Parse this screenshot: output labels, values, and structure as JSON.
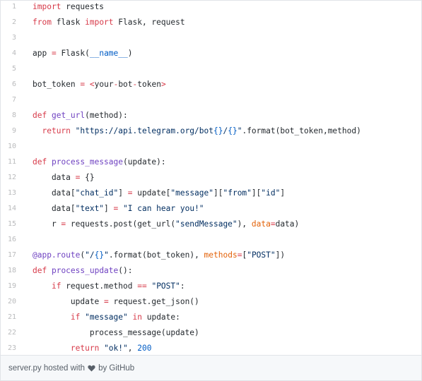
{
  "code": {
    "lines": [
      {
        "n": "1",
        "tokens": [
          [
            "k",
            "import"
          ],
          [
            "p",
            " requests"
          ]
        ]
      },
      {
        "n": "2",
        "tokens": [
          [
            "k",
            "from"
          ],
          [
            "p",
            " flask "
          ],
          [
            "k",
            "import"
          ],
          [
            "p",
            " Flask, request"
          ]
        ]
      },
      {
        "n": "3",
        "tokens": []
      },
      {
        "n": "4",
        "tokens": [
          [
            "p",
            "app "
          ],
          [
            "k",
            "="
          ],
          [
            "p",
            " Flask("
          ],
          [
            "c",
            "__name__"
          ],
          [
            "p",
            ")"
          ]
        ]
      },
      {
        "n": "5",
        "tokens": []
      },
      {
        "n": "6",
        "tokens": [
          [
            "p",
            "bot_token "
          ],
          [
            "k",
            "="
          ],
          [
            "p",
            " "
          ],
          [
            "k",
            "<"
          ],
          [
            "p",
            "your"
          ],
          [
            "k",
            "-"
          ],
          [
            "p",
            "bot"
          ],
          [
            "k",
            "-"
          ],
          [
            "p",
            "token"
          ],
          [
            "k",
            ">"
          ]
        ]
      },
      {
        "n": "7",
        "tokens": []
      },
      {
        "n": "8",
        "tokens": [
          [
            "k",
            "def"
          ],
          [
            "p",
            " "
          ],
          [
            "f",
            "get_url"
          ],
          [
            "p",
            "(method):"
          ]
        ]
      },
      {
        "n": "9",
        "tokens": [
          [
            "p",
            "  "
          ],
          [
            "k",
            "return"
          ],
          [
            "p",
            " "
          ],
          [
            "s",
            "\"https://api.telegram.org/bot"
          ],
          [
            "c",
            "{}"
          ],
          [
            "s",
            "/"
          ],
          [
            "c",
            "{}"
          ],
          [
            "s",
            "\""
          ],
          [
            "p",
            ".format(bot_token,method)"
          ]
        ]
      },
      {
        "n": "10",
        "tokens": []
      },
      {
        "n": "11",
        "tokens": [
          [
            "k",
            "def"
          ],
          [
            "p",
            " "
          ],
          [
            "f",
            "process_message"
          ],
          [
            "p",
            "(update):"
          ]
        ]
      },
      {
        "n": "12",
        "tokens": [
          [
            "p",
            "    data "
          ],
          [
            "k",
            "="
          ],
          [
            "p",
            " {}"
          ]
        ]
      },
      {
        "n": "13",
        "tokens": [
          [
            "p",
            "    data["
          ],
          [
            "s",
            "\"chat_id\""
          ],
          [
            "p",
            "] "
          ],
          [
            "k",
            "="
          ],
          [
            "p",
            " update["
          ],
          [
            "s",
            "\"message\""
          ],
          [
            "p",
            "]["
          ],
          [
            "s",
            "\"from\""
          ],
          [
            "p",
            "]["
          ],
          [
            "s",
            "\"id\""
          ],
          [
            "p",
            "]"
          ]
        ]
      },
      {
        "n": "14",
        "tokens": [
          [
            "p",
            "    data["
          ],
          [
            "s",
            "\"text\""
          ],
          [
            "p",
            "] "
          ],
          [
            "k",
            "="
          ],
          [
            "p",
            " "
          ],
          [
            "s",
            "\"I can hear you!\""
          ]
        ]
      },
      {
        "n": "15",
        "tokens": [
          [
            "p",
            "    r "
          ],
          [
            "k",
            "="
          ],
          [
            "p",
            " requests.post(get_url("
          ],
          [
            "s",
            "\"sendMessage\""
          ],
          [
            "p",
            "), "
          ],
          [
            "a",
            "data"
          ],
          [
            "k",
            "="
          ],
          [
            "p",
            "data)"
          ]
        ]
      },
      {
        "n": "16",
        "tokens": []
      },
      {
        "n": "17",
        "tokens": [
          [
            "f",
            "@app.route"
          ],
          [
            "p",
            "("
          ],
          [
            "s",
            "\"/"
          ],
          [
            "c",
            "{}"
          ],
          [
            "s",
            "\""
          ],
          [
            "p",
            ".format(bot_token), "
          ],
          [
            "a",
            "methods"
          ],
          [
            "k",
            "="
          ],
          [
            "p",
            "["
          ],
          [
            "s",
            "\"POST\""
          ],
          [
            "p",
            "])"
          ]
        ]
      },
      {
        "n": "18",
        "tokens": [
          [
            "k",
            "def"
          ],
          [
            "p",
            " "
          ],
          [
            "f",
            "process_update"
          ],
          [
            "p",
            "():"
          ]
        ]
      },
      {
        "n": "19",
        "tokens": [
          [
            "p",
            "    "
          ],
          [
            "k",
            "if"
          ],
          [
            "p",
            " request.method "
          ],
          [
            "k",
            "=="
          ],
          [
            "p",
            " "
          ],
          [
            "s",
            "\"POST\""
          ],
          [
            "p",
            ":"
          ]
        ]
      },
      {
        "n": "20",
        "tokens": [
          [
            "p",
            "        update "
          ],
          [
            "k",
            "="
          ],
          [
            "p",
            " request.get_json()"
          ]
        ]
      },
      {
        "n": "21",
        "tokens": [
          [
            "p",
            "        "
          ],
          [
            "k",
            "if"
          ],
          [
            "p",
            " "
          ],
          [
            "s",
            "\"message\""
          ],
          [
            "p",
            " "
          ],
          [
            "k",
            "in"
          ],
          [
            "p",
            " update:"
          ]
        ]
      },
      {
        "n": "22",
        "tokens": [
          [
            "p",
            "            process_message(update)"
          ]
        ]
      },
      {
        "n": "23",
        "tokens": [
          [
            "p",
            "        "
          ],
          [
            "k",
            "return"
          ],
          [
            "p",
            " "
          ],
          [
            "s",
            "\"ok!\""
          ],
          [
            "p",
            ", "
          ],
          [
            "c",
            "200"
          ]
        ]
      }
    ]
  },
  "footer": {
    "filename": "server.py",
    "hosted_with": "hosted with",
    "heart_icon": "heart-icon",
    "by": "by GitHub"
  },
  "colors": {
    "keyword": "#d73a49",
    "function": "#6f42c1",
    "string": "#032f62",
    "constant": "#005cc5",
    "param": "#e36209",
    "line_number": "#babbbd"
  }
}
